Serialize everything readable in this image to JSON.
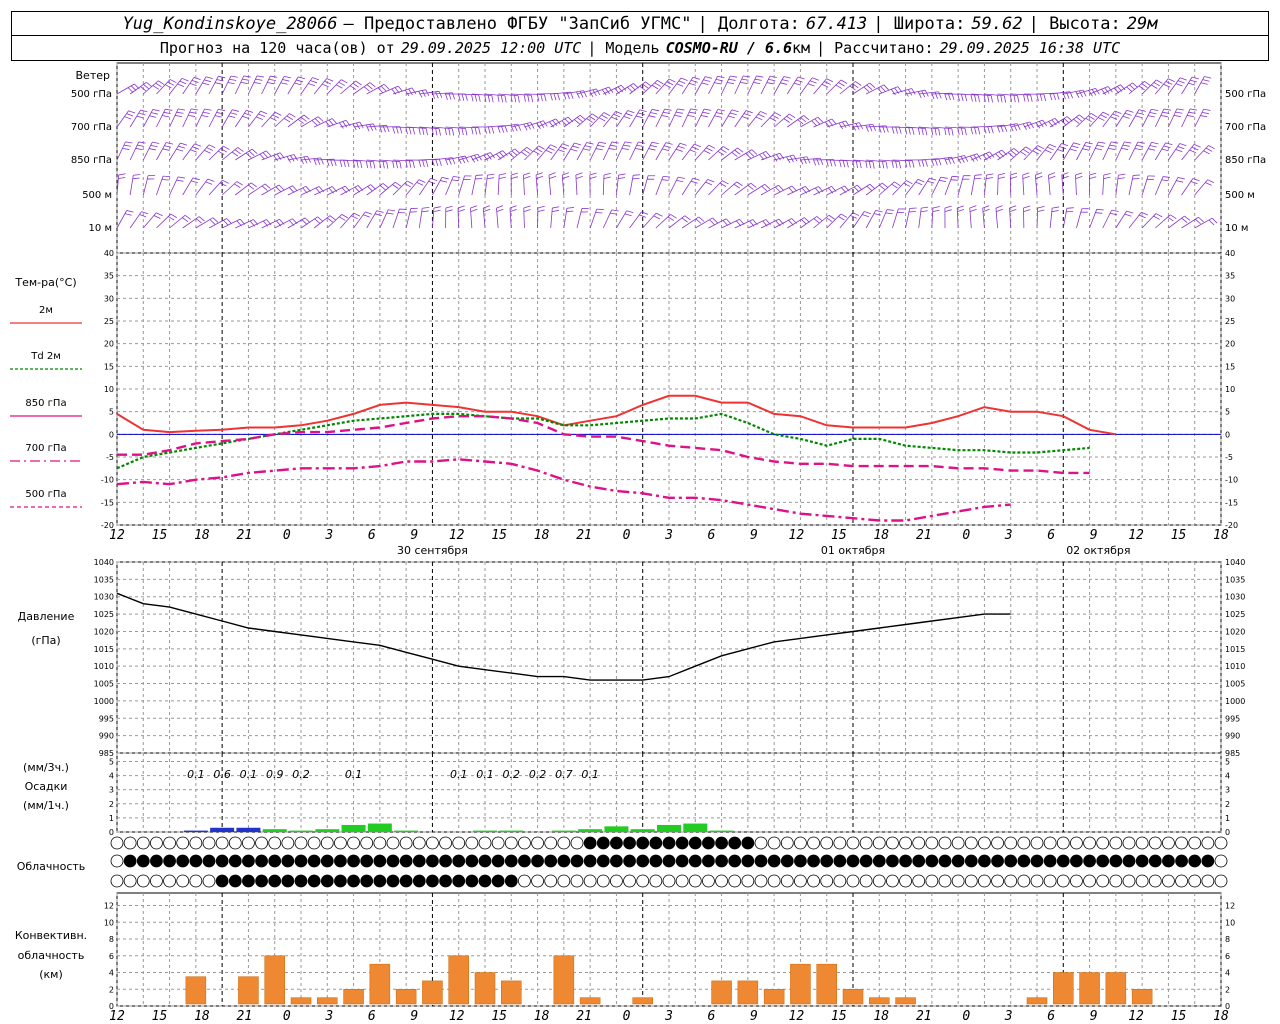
{
  "header": {
    "station": "Yug_Kondinskoye_28066",
    "provided": "– Предоставлено ФГБУ \"ЗапСиб УГМС\"",
    "lon_label": "| Долгота:",
    "lon": "67.413",
    "lat_label": "| Широта:",
    "lat": "59.62",
    "alt_label": "| Высота:",
    "alt": "29м",
    "forecast_label": "Прогноз на 120 часа(ов) от",
    "forecast_from": "29.09.2025 12:00 UTC",
    "model_label": "| Модель",
    "model": "COSMO-RU / 6.6",
    "model_unit": "км",
    "calc_label": "| Рассчитано:",
    "calc_time": "29.09.2025 16:38 UTC"
  },
  "colors": {
    "t2m": "#ee3333",
    "td2m": "#008800",
    "t850": "#dd1188",
    "t700": "#dd1188",
    "t500": "#dd1188",
    "wind": "#8833cc",
    "zero": "#0000cc",
    "precip": "#22cc22",
    "precip_low": "#2233cc",
    "conv": "#ee8833",
    "grid": "#999999"
  },
  "wind_panel": {
    "title": "Ветер",
    "levels": [
      "500 гПа",
      "700 гПа",
      "850 гПа",
      "500 м",
      "10  м"
    ]
  },
  "temp_panel": {
    "title": "Тем-ра(°C)",
    "legend": [
      "2м",
      "Td  2м",
      "850 гПа",
      "700 гПа",
      "500 гПа"
    ],
    "yticks": [
      "40",
      "35",
      "30",
      "25",
      "20",
      "15",
      "10",
      "5",
      "0",
      "-5",
      "-10",
      "-15",
      "-20"
    ]
  },
  "pressure_panel": {
    "title1": "Давление",
    "title2": "(гПа)",
    "yticks": [
      "1040",
      "1035",
      "1030",
      "1025",
      "1020",
      "1015",
      "1010",
      "1005",
      "1000",
      "995",
      "990",
      "985"
    ]
  },
  "precip_panel": {
    "title1": "(мм/3ч.)",
    "title2": "Осадки",
    "title3": "(мм/1ч.)",
    "yticks": [
      "5",
      "4",
      "3",
      "2",
      "1",
      "0"
    ],
    "labels": [
      "0.1",
      "0.6",
      "0.1",
      "0.9",
      "0.2",
      "0.1",
      "0.1",
      "0.1",
      "0.2",
      "0.2",
      "0.7",
      "0.1"
    ]
  },
  "cloud_panel": {
    "title": "Облачность"
  },
  "conv_panel": {
    "title1": "Конвективн.",
    "title2": "облачность",
    "title3": "(км)",
    "yticks": [
      "12",
      "10",
      "8",
      "6",
      "4",
      "2",
      "0"
    ]
  },
  "time_axis": {
    "hours": [
      "12",
      "15",
      "18",
      "21",
      "0",
      "3",
      "6",
      "9",
      "12",
      "15",
      "18",
      "21",
      "0",
      "3",
      "6",
      "9",
      "12",
      "15",
      "18",
      "21",
      "0",
      "3",
      "6",
      "9",
      "12",
      "15",
      "18"
    ],
    "dates": [
      "30 сентября",
      "01 октября",
      "02 октября"
    ]
  },
  "chart_data": [
    {
      "type": "line",
      "x_hours_from_start": [
        0,
        3,
        6,
        9,
        12,
        15,
        18,
        21,
        24,
        27,
        30,
        33,
        36,
        39,
        42,
        45,
        48,
        51,
        54,
        57,
        60,
        63,
        66,
        69,
        72,
        75,
        78,
        81,
        84,
        87,
        90,
        93,
        96,
        99,
        102,
        105,
        108,
        111,
        114,
        117,
        120,
        123,
        126
      ],
      "series": [
        {
          "name": "2м",
          "values": [
            4.5,
            1,
            0.5,
            0.8,
            1,
            1.5,
            1.5,
            2,
            3,
            4.5,
            6.5,
            7,
            6.5,
            6,
            5,
            5,
            4,
            2,
            3,
            4,
            6.5,
            8.5,
            8.5,
            7,
            7,
            4.5,
            4,
            2,
            1.5,
            1.5,
            1.5,
            2.5,
            4,
            6,
            5,
            5,
            4,
            1,
            0,
            null,
            null,
            null,
            null
          ]
        },
        {
          "name": "Td  2м",
          "values": [
            -7.5,
            -5,
            -4,
            -3,
            -2,
            -1,
            0,
            1,
            2,
            3,
            3.5,
            4,
            4.5,
            4.5,
            4,
            3.5,
            3.5,
            2,
            2,
            2.5,
            3,
            3.5,
            3.5,
            4.5,
            2.5,
            0,
            -1,
            -2.5,
            -1,
            -1,
            -2.5,
            -3,
            -3.5,
            -3.5,
            -4,
            -4,
            -3.5,
            -3,
            null,
            null,
            null,
            null,
            null
          ]
        },
        {
          "name": "850 гПа",
          "values": [
            -4.5,
            -4.5,
            -3.5,
            -2,
            -1.5,
            -1,
            0,
            0.5,
            0.5,
            1,
            1.5,
            2.5,
            3.5,
            4,
            4,
            3.5,
            2.5,
            0,
            -0.5,
            -0.5,
            -1.5,
            -2.5,
            -3,
            -3.5,
            -5,
            -6,
            -6.5,
            -6.5,
            -7,
            -7,
            -7,
            -7,
            -7.5,
            -7.5,
            -8,
            -8,
            -8.5,
            -8.5,
            null,
            null,
            null,
            null,
            null
          ]
        },
        {
          "name": "700 гПа",
          "values": [
            -11,
            -10.5,
            -11,
            -10,
            -9.5,
            -8.5,
            -8,
            -7.5,
            -7.5,
            -7.5,
            -7,
            -6,
            -6,
            -5.5,
            -6,
            -6.5,
            -8,
            -10,
            -11.5,
            -12.5,
            -13,
            -14,
            -14,
            -14.5,
            -15.5,
            -16.5,
            -17.5,
            -18,
            -18.5,
            -19,
            -19,
            -18,
            -17,
            -16,
            -15.5,
            null,
            null,
            null,
            null,
            null,
            null,
            null,
            null
          ]
        }
      ],
      "xlabel": "",
      "ylabel": "Тем-ра(°C)",
      "ylim": [
        -20,
        40
      ]
    },
    {
      "type": "line",
      "x_hours_from_start": [
        0,
        3,
        6,
        9,
        12,
        15,
        18,
        21,
        24,
        27,
        30,
        33,
        36,
        39,
        42,
        45,
        48,
        51,
        54,
        57,
        60,
        63,
        66,
        69,
        72,
        75,
        78,
        81,
        84,
        87,
        90,
        93,
        96,
        99,
        102,
        105,
        108,
        111,
        114,
        117,
        120
      ],
      "series": [
        {
          "name": "Давление",
          "values": [
            1031,
            1028,
            1027,
            1025,
            1023,
            1021,
            1020,
            1019,
            1018,
            1017,
            1016,
            1014,
            1012,
            1010,
            1009,
            1008,
            1007,
            1007,
            1006,
            1006,
            1006,
            1007,
            1010,
            1013,
            1015,
            1017,
            1018,
            1019,
            1020,
            1021,
            1022,
            1023,
            1024,
            1025,
            1025,
            null,
            null,
            null,
            null,
            null,
            null
          ]
        }
      ],
      "ylabel": "Давление (гПа)",
      "ylim": [
        985,
        1040
      ]
    },
    {
      "type": "bar",
      "x_hours_from_start": [
        9,
        12,
        15,
        18,
        21,
        24,
        27,
        30,
        33,
        42,
        45,
        51,
        54,
        57,
        60,
        63,
        66,
        69
      ],
      "series": [
        {
          "name": "Осадки",
          "values": [
            0.1,
            0.3,
            0.3,
            0.2,
            0.1,
            0.2,
            0.5,
            0.6,
            0.1,
            0.1,
            0.1,
            0.1,
            0.2,
            0.4,
            0.2,
            0.5,
            0.6,
            0.1
          ]
        }
      ],
      "ylabel": "Осадки (мм/1ч.)",
      "ylim": [
        0,
        5
      ]
    },
    {
      "type": "bar",
      "x_hours_from_start": [
        9,
        12,
        15,
        18,
        21,
        24,
        27,
        30,
        33,
        36,
        39,
        42,
        45,
        48,
        51,
        54,
        57,
        60,
        63,
        66,
        69,
        72,
        75,
        78,
        81,
        84,
        87,
        90,
        93,
        96,
        99,
        102,
        105,
        108,
        111,
        114,
        117
      ],
      "series": [
        {
          "name": "Конвективн. облачность (км)",
          "values": [
            3.5,
            0,
            3.5,
            6,
            1,
            1,
            2,
            5,
            2,
            3,
            6,
            4,
            3,
            0,
            6,
            1,
            0,
            1,
            0,
            0,
            3,
            3,
            2,
            5,
            5,
            2,
            1,
            1,
            0,
            0,
            0,
            0,
            1,
            4,
            4,
            4,
            2
          ]
        }
      ],
      "ylim": [
        0,
        13
      ]
    }
  ]
}
